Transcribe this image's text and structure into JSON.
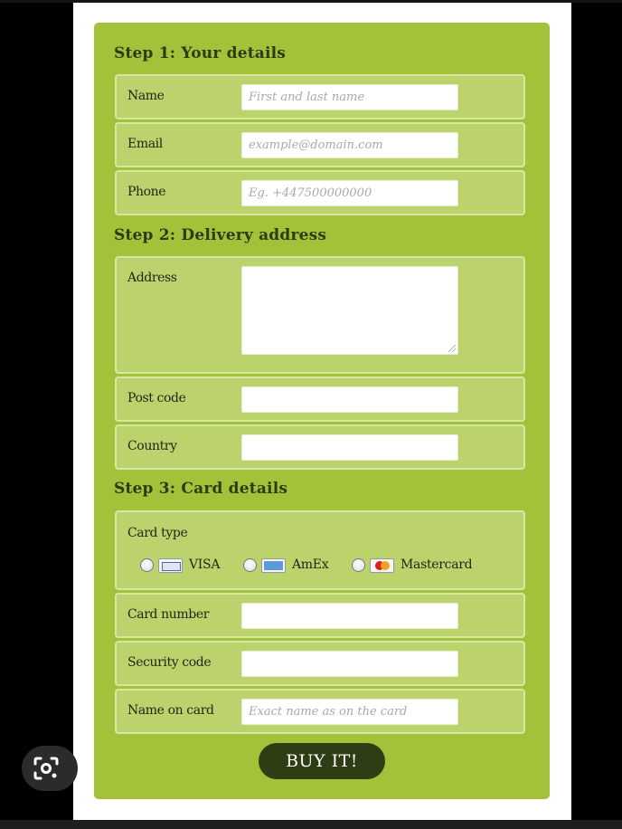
{
  "form": {
    "step1": {
      "title": "Step 1: Your details",
      "fields": [
        {
          "label": "Name",
          "placeholder": "First and last name",
          "value": ""
        },
        {
          "label": "Email",
          "placeholder": "example@domain.com",
          "value": ""
        },
        {
          "label": "Phone",
          "placeholder": "Eg. +447500000000",
          "value": ""
        }
      ]
    },
    "step2": {
      "title": "Step 2: Delivery address",
      "fields": [
        {
          "label": "Address",
          "placeholder": "",
          "value": ""
        },
        {
          "label": "Post code",
          "placeholder": "",
          "value": ""
        },
        {
          "label": "Country",
          "placeholder": "",
          "value": ""
        }
      ]
    },
    "step3": {
      "title": "Step 3: Card details",
      "card_type": {
        "label": "Card type",
        "options": [
          {
            "label": "VISA",
            "icon": "visa-card-icon"
          },
          {
            "label": "AmEx",
            "icon": "amex-card-icon"
          },
          {
            "label": "Mastercard",
            "icon": "mastercard-card-icon"
          }
        ]
      },
      "fields": [
        {
          "label": "Card number",
          "placeholder": "",
          "value": ""
        },
        {
          "label": "Security code",
          "placeholder": "",
          "value": ""
        },
        {
          "label": "Name on card",
          "placeholder": "Exact name as on the card",
          "value": ""
        }
      ]
    },
    "submit_label": "BUY IT!"
  },
  "overlay": {
    "icon": "lens-search-icon"
  },
  "colors": {
    "panel": "#a4c239",
    "row": "#bcd36d",
    "button": "#2f3d14",
    "heading": "#2e3a13"
  }
}
